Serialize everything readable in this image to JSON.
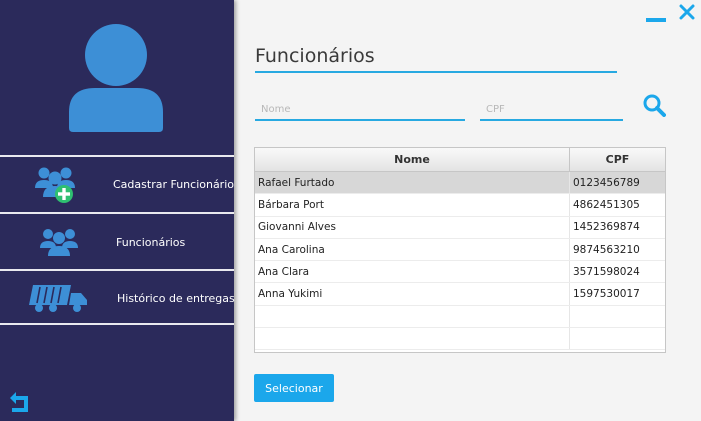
{
  "sidebar": {
    "items": [
      {
        "label": "Cadastrar Funcionário",
        "icon": "add-user-group-icon"
      },
      {
        "label": "Funcionários",
        "icon": "users-group-icon"
      },
      {
        "label": "Histórico de entregas",
        "icon": "truck-icon"
      }
    ],
    "back_icon": "back-arrow-icon"
  },
  "window": {
    "minimize_icon": "minimize-icon",
    "close_icon": "close-icon"
  },
  "main": {
    "title": "Funcionários",
    "search": {
      "nome_placeholder": "Nome",
      "cpf_placeholder": "CPF",
      "icon": "search-icon"
    },
    "table": {
      "columns": [
        "Nome",
        "CPF"
      ],
      "rows": [
        {
          "nome": "Rafael Furtado",
          "cpf": "0123456789"
        },
        {
          "nome": "Bárbara Port",
          "cpf": "4862451305"
        },
        {
          "nome": "Giovanni Alves",
          "cpf": "1452369874"
        },
        {
          "nome": "Ana Carolina",
          "cpf": "9874563210"
        },
        {
          "nome": "Ana Clara",
          "cpf": "3571598024"
        },
        {
          "nome": "Anna Yukimi",
          "cpf": "1597530017"
        }
      ]
    },
    "select_button": "Selecionar"
  },
  "colors": {
    "sidebar": "#2b2a5b",
    "accent": "#27a9e1",
    "button": "#1ba7eb",
    "icon": "#3d8fd6"
  }
}
